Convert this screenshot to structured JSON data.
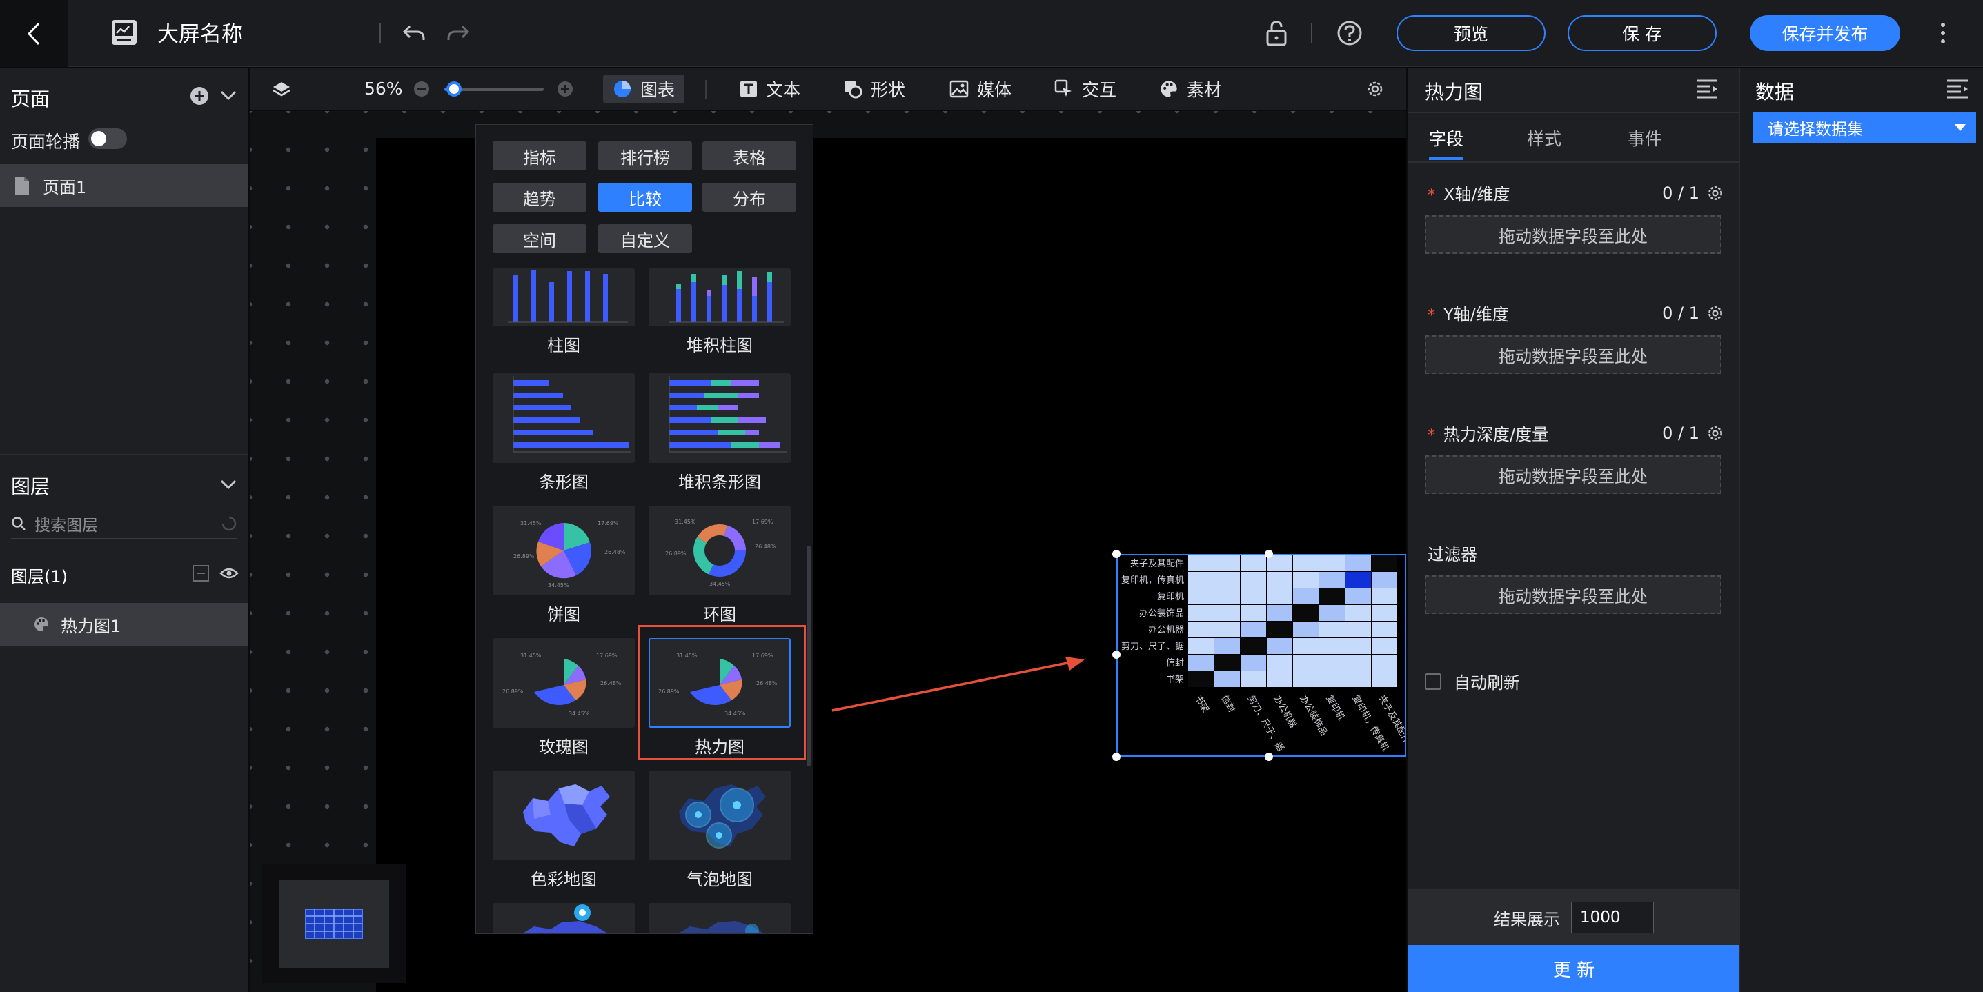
{
  "app": {
    "title": "大屏名称"
  },
  "top_actions": {
    "preview": "预览",
    "save": "保 存",
    "publish": "保存并发布"
  },
  "left": {
    "pages_title": "页面",
    "carousel_label": "页面轮播",
    "page_item": "页面1",
    "layers_title": "图层",
    "search_placeholder": "搜索图层",
    "layers_count": "图层(1)",
    "layer_item": "热力图1"
  },
  "toolbar": {
    "zoom": "56%",
    "zoom_level": 0.1,
    "items": [
      "图表",
      "文本",
      "形状",
      "媒体",
      "交互",
      "素材"
    ]
  },
  "chart_menu": {
    "categories": [
      "指标",
      "排行榜",
      "表格",
      "趋势",
      "比较",
      "分布",
      "空间",
      "自定义"
    ],
    "active_category": "比较",
    "charts": [
      "柱图",
      "堆积柱图",
      "条形图",
      "堆积条形图",
      "饼图",
      "环图",
      "玫瑰图",
      "热力图",
      "色彩地图",
      "气泡地图"
    ],
    "selected_chart": "热力图",
    "thumb_pie_labels": [
      "31.45%",
      "17.69%",
      "26.89%",
      "26.48%",
      "34.45%"
    ]
  },
  "heatmap": {
    "row_labels": [
      "书架",
      "信封",
      "剪刀、尺子、锯",
      "办公机器",
      "办公装饰品",
      "复印机",
      "复印机，传真机",
      "夹子及其配件"
    ],
    "col_labels": [
      "书架",
      "信封",
      "剪刀、尺子、锯",
      "办公机器",
      "办公装饰品",
      "复印机",
      "复印机，传真机",
      "夹子及其配件"
    ]
  },
  "config": {
    "title": "热力图",
    "tabs": [
      "字段",
      "样式",
      "事件"
    ],
    "active_tab": "字段",
    "sections": [
      {
        "label": "X轴/维度",
        "count": "0 / 1",
        "drop": "拖动数据字段至此处",
        "required": true
      },
      {
        "label": "Y轴/维度",
        "count": "0 / 1",
        "drop": "拖动数据字段至此处",
        "required": true
      },
      {
        "label": "热力深度/度量",
        "count": "0 / 1",
        "drop": "拖动数据字段至此处",
        "required": true
      },
      {
        "label": "过滤器",
        "count": "",
        "drop": "拖动数据字段至此处",
        "required": false
      }
    ],
    "auto_refresh": "自动刷新",
    "result_label": "结果展示",
    "result_value": "1000",
    "update": "更 新"
  },
  "data_panel": {
    "title": "数据",
    "select": "请选择数据集"
  },
  "colors": {
    "accent": "#2f80ff",
    "highlight": "#e8503e",
    "heat_light": "#c6dafc",
    "heat_mid": "#a6c2f8",
    "heat_dark": "#0a0a0a"
  }
}
